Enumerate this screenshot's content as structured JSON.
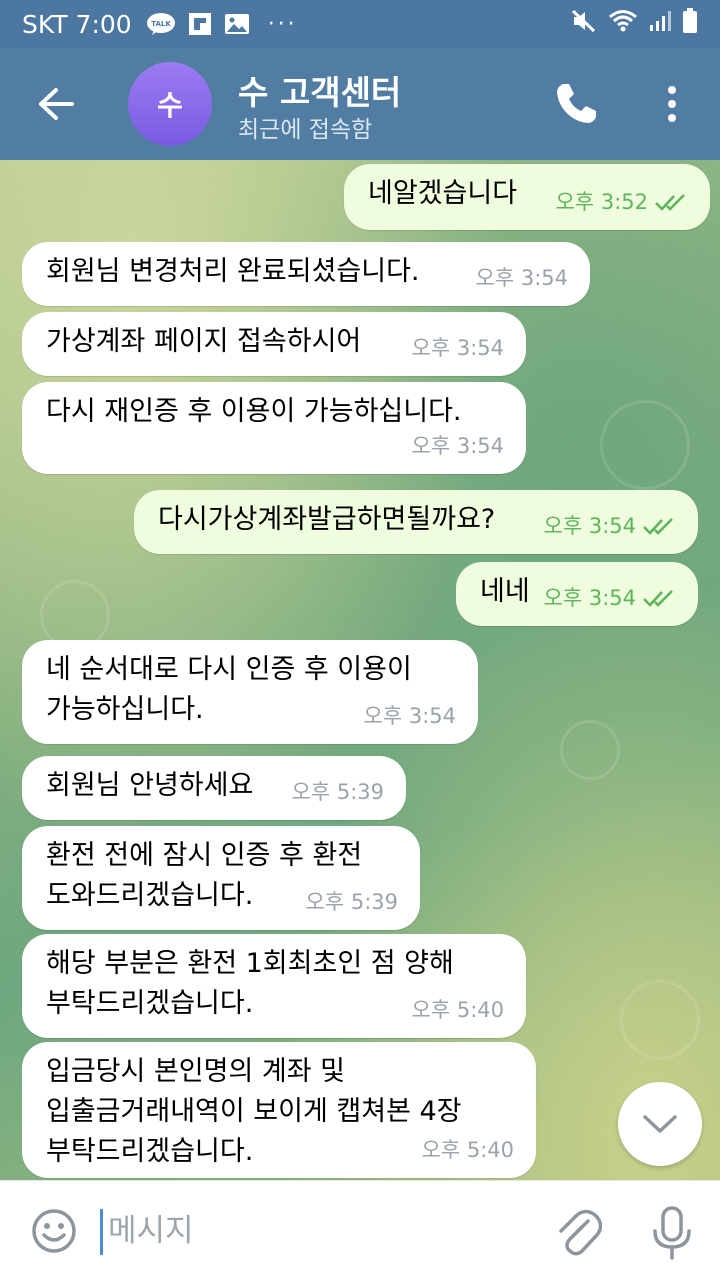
{
  "status_bar": {
    "carrier_time": "SKT 7:00",
    "talk_badge": "TALK"
  },
  "header": {
    "avatar_letter": "수",
    "title": "수 고객센터",
    "subtitle": "최근에 접속함"
  },
  "messages": [
    {
      "dir": "out",
      "text": "네알겠습니다",
      "time": "오후 3:52"
    },
    {
      "dir": "in",
      "text": "회원님 변경처리 완료되셨습니다.",
      "time": "오후 3:54"
    },
    {
      "dir": "in",
      "text": "가상계좌 페이지 접속하시어",
      "time": "오후 3:54"
    },
    {
      "dir": "in",
      "text": "다시 재인증 후 이용이 가능하십니다.",
      "time": "오후 3:54"
    },
    {
      "dir": "out",
      "text": "다시가상계좌발급하면될까요?",
      "time": "오후 3:54"
    },
    {
      "dir": "out",
      "text": "네네",
      "time": "오후 3:54"
    },
    {
      "dir": "in",
      "text": "네 순서대로 다시 인증 후 이용이\n가능하십니다.",
      "time": "오후 3:54"
    },
    {
      "dir": "in",
      "text": "회원님 안녕하세요",
      "time": "오후 5:39"
    },
    {
      "dir": "in",
      "text": "환전 전에 잠시 인증 후 환전\n도와드리겠습니다.",
      "time": "오후 5:39"
    },
    {
      "dir": "in",
      "text": "해당 부분은 환전 1회최초인 점 양해\n부탁드리겠습니다.",
      "time": "오후 5:40"
    },
    {
      "dir": "in",
      "text": "입금당시 본인명의 계좌 및\n입출금거래내역이 보이게 캡쳐본 4장\n부탁드리겠습니다.",
      "time": "오후 5:40"
    }
  ],
  "input": {
    "placeholder": "메시지"
  },
  "colors": {
    "header": "#517da2",
    "outgoing_bubble": "#effdde",
    "incoming_bubble": "#ffffff",
    "read_check": "#5eb55c"
  }
}
